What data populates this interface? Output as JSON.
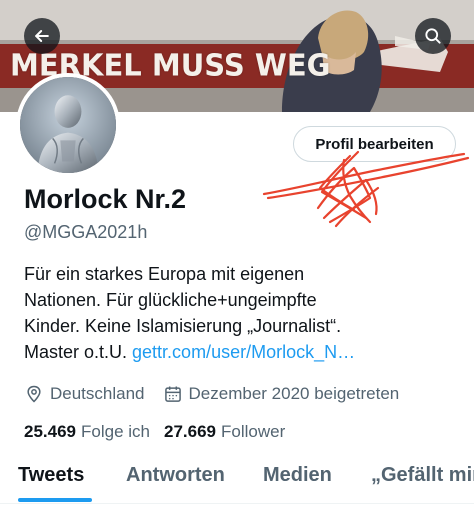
{
  "header": {
    "banner_slogan": "MERKEL MUSS WEG",
    "back_icon": "arrow-left-icon",
    "search_icon": "search-icon"
  },
  "profile": {
    "edit_button_label": "Profil bearbeiten",
    "display_name": "Morlock Nr.2",
    "handle": "@MGGA2021h",
    "bio_lines": [
      "Für ein starkes Europa mit eigenen",
      "Nationen. Für glückliche+ungeimpfte",
      "Kinder. Keine Islamisierung „Journalist“."
    ],
    "bio_last_prefix": "Master o.t.U. ",
    "bio_link": "gettr.com/user/Morlock_N…",
    "location": "Deutschland",
    "location_icon": "location-pin-icon",
    "joined": "Dezember 2020 beigetreten",
    "joined_icon": "calendar-icon"
  },
  "stats": {
    "following_count": "25.469",
    "following_label": "Folge ich",
    "followers_count": "27.669",
    "followers_label": "Follower"
  },
  "tabs": [
    {
      "label": "Tweets",
      "active": true
    },
    {
      "label": "Antworten",
      "active": false
    },
    {
      "label": "Medien",
      "active": false
    },
    {
      "label": "„Gefällt mir“",
      "active": false
    }
  ],
  "colors": {
    "accent": "#1d9bf0",
    "text": "#0f1419",
    "secondary_text": "#536471",
    "scribble": "#e8432e"
  }
}
